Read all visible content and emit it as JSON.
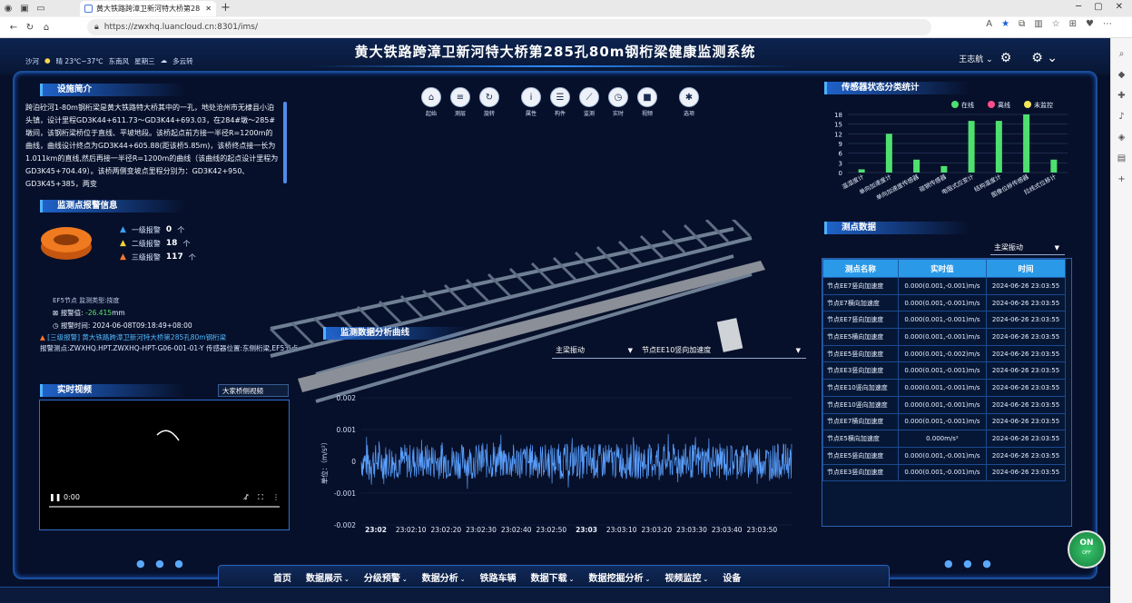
{
  "browser": {
    "tab_title": "黄大铁路跨漳卫新河特大桥第28",
    "url": "https://zwxhq.luancloud.cn:8301/ims/"
  },
  "header": {
    "title": "黄大铁路跨漳卫新河特大桥第285孔80m钢桁梁健康监测系统",
    "location": "沙河",
    "weather": "晴 23℃~37℃",
    "wind": "东南风",
    "weekday": "星期三",
    "forecast": "多云转",
    "user": "王志航"
  },
  "toolbar": [
    {
      "icon": "home-icon",
      "label": "起始",
      "glyph": "⌂"
    },
    {
      "icon": "list-icon",
      "label": "测层",
      "glyph": "≡"
    },
    {
      "icon": "rotate-icon",
      "label": "旋转",
      "glyph": "↻"
    },
    {
      "icon": "info-icon",
      "label": "属性",
      "glyph": "i"
    },
    {
      "icon": "component-icon",
      "label": "构件",
      "glyph": "☰"
    },
    {
      "icon": "monitor-icon",
      "label": "监测",
      "glyph": "⟋"
    },
    {
      "icon": "realtime-icon",
      "label": "实时",
      "glyph": "◷"
    },
    {
      "icon": "video-icon",
      "label": "视频",
      "glyph": "■"
    },
    {
      "icon": "options-icon",
      "label": "选项",
      "glyph": "✱"
    }
  ],
  "intro": {
    "title": "设施简介",
    "text": "跨泊砼河1-80m钢桁梁是黄大铁路特大桥其中的一孔，地处沧州市无棣县小泊头镇，设计里程GD3K44+611.73～GD3K44+693.03，在284#墩～285#墩间，该钢桁梁桥位于直线、平坡地段。该桥起点前方接一半径R=1200m的曲线，曲线设计终点为GD3K44+605.88(距该桥5.85m)，该桥终点接一长为1.011km的直线,然后再接一半径R=1200m的曲线（该曲线的起点设计里程为GD3K45+704.49）。该桥两侧变坡点里程分别为：GD3K42+950、GD3K45+385，两变"
  },
  "alarm": {
    "title": "监测点报警信息",
    "levels": [
      {
        "label": "一级报警",
        "count": "0",
        "unit": "个",
        "color": "#3aa0ff"
      },
      {
        "label": "二级报警",
        "count": "18",
        "unit": "个",
        "color": "#f2d23a"
      },
      {
        "label": "三级报警",
        "count": "117",
        "unit": "个",
        "color": "#ff7a2a"
      }
    ],
    "detail_line": "EF5节点 监测类型:挠度",
    "value_label": "报警值:",
    "value": "-26.415",
    "value_unit": "mm",
    "time_label": "报警时间:",
    "time": "2024-06-08T09:18:49+08:00",
    "link_level": "[三级报警]",
    "link_text": "黄大铁路跨漳卫新河特大桥第285孔80m钢桁梁",
    "link_point": "报警测点:ZWXHQ.HPT.ZWXHQ-HPT-G06-001-01-Y 传感器位置:东侧桁梁,EF5节点 监测类:主梁挠度"
  },
  "video": {
    "title": "实时视频",
    "camera": "大家桥侧视频",
    "time": "0:00"
  },
  "curve": {
    "title": "监测数据分析曲线",
    "select_type": "主梁振动",
    "select_point": "节点EE10竖向加速度"
  },
  "chart_data": [
    {
      "type": "line",
      "title": "监测数据分析曲线",
      "ylabel": "单位：（m/s²）",
      "xlabel": "",
      "ylim": [
        -0.002,
        0.002
      ],
      "y_ticks": [
        "0.002",
        "0.001",
        "0",
        "-0.001",
        "-0.002"
      ],
      "x_ticks": [
        "23:02",
        "23:02:10",
        "23:02:20",
        "23:02:30",
        "23:02:40",
        "23:02:50",
        "23:03",
        "23:03:10",
        "23:03:20",
        "23:03:30",
        "23:03:40",
        "23:03:50"
      ],
      "series": [
        {
          "amplitude": 0.0007,
          "color": "#5aa0ff"
        }
      ]
    },
    {
      "type": "bar",
      "title": "传感器状态分类统计",
      "legend": [
        {
          "name": "在线",
          "color": "#4ee06f"
        },
        {
          "name": "离线",
          "color": "#ff4d8a"
        },
        {
          "name": "未监控",
          "color": "#f5e65a"
        }
      ],
      "categories": [
        "温湿度计",
        "单向加速度计",
        "单向加速度传感器",
        "碰钢传感器",
        "电阻式应变计",
        "结构温度计",
        "图像位移传感器",
        "拉线式位移计"
      ],
      "values": [
        1,
        12,
        4,
        2,
        16,
        16,
        18,
        4
      ],
      "ylim": [
        0,
        18
      ],
      "y_ticks": [
        "0",
        "3",
        "6",
        "9",
        "12",
        "15",
        "18"
      ]
    }
  ],
  "measure": {
    "title": "测点数据",
    "select": "主梁振动",
    "headers": [
      "测点名称",
      "实时值",
      "时间"
    ],
    "rows": [
      [
        "节点EE7竖向加速度",
        "0.000(0.001,-0.001)m/s",
        "2024-06-26 23:03:55"
      ],
      [
        "节点E7横向加速度",
        "0.000(0.001,-0.001)m/s",
        "2024-06-26 23:03:55"
      ],
      [
        "节点EE7竖向加速度",
        "0.000(0.001,-0.001)m/s",
        "2024-06-26 23:03:55"
      ],
      [
        "节点EE5横向加速度",
        "0.000(0.001,-0.001)m/s",
        "2024-06-26 23:03:55"
      ],
      [
        "节点EE5竖向加速度",
        "0.000(0.001,-0.002)m/s",
        "2024-06-26 23:03:55"
      ],
      [
        "节点EE3竖向加速度",
        "0.000(0.001,-0.001)m/s",
        "2024-06-26 23:03:55"
      ],
      [
        "节点EE10竖向加速度",
        "0.000(0.001,-0.001)m/s",
        "2024-06-26 23:03:55"
      ],
      [
        "节点EE10竖向加速度",
        "0.000(0.001,-0.001)m/s",
        "2024-06-26 23:03:55"
      ],
      [
        "节点EE7横向加速度",
        "0.000(0.001,-0.001)m/s",
        "2024-06-26 23:03:55"
      ],
      [
        "节点E5横向加速度",
        "0.000m/s²",
        "2024-06-26 23:03:55"
      ],
      [
        "节点EE5竖向加速度",
        "0.000(0.001,-0.001)m/s",
        "2024-06-26 23:03:55"
      ],
      [
        "节点EE3竖向加速度",
        "0.000(0.001,-0.001)m/s",
        "2024-06-26 23:03:55"
      ]
    ]
  },
  "status_button": {
    "on": "ON",
    "off": "OFF"
  },
  "nav": [
    {
      "label": "首页",
      "dropdown": false
    },
    {
      "label": "数据展示",
      "dropdown": true
    },
    {
      "label": "分级预警",
      "dropdown": true
    },
    {
      "label": "数据分析",
      "dropdown": true
    },
    {
      "label": "铁路车辆",
      "dropdown": false
    },
    {
      "label": "数据下载",
      "dropdown": true
    },
    {
      "label": "数据挖掘分析",
      "dropdown": true
    },
    {
      "label": "视频监控",
      "dropdown": true
    },
    {
      "label": "设备",
      "dropdown": false
    }
  ]
}
